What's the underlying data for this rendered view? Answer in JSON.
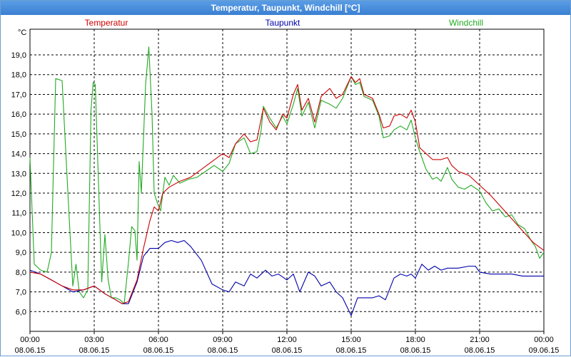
{
  "window": {
    "title": "Temperatur, Taupunkt, Windchill [°C]"
  },
  "colors": {
    "temperatur": "#cc0000",
    "taupunkt": "#0000aa",
    "windchill": "#22aa22",
    "grid": "#000000"
  },
  "chart_data": {
    "type": "line",
    "title": "Temperatur, Taupunkt, Windchill [°C]",
    "ylabel": "°C",
    "ylim": [
      5.0,
      20.3
    ],
    "xlim": [
      0,
      24
    ],
    "grid": true,
    "legend_placement": "top",
    "yticks": [
      "6,0",
      "7,0",
      "8,0",
      "9,0",
      "10,0",
      "11,0",
      "12,0",
      "13,0",
      "14,0",
      "15,0",
      "16,0",
      "17,0",
      "18,0",
      "19,0"
    ],
    "ytick_values": [
      6,
      7,
      8,
      9,
      10,
      11,
      12,
      13,
      14,
      15,
      16,
      17,
      18,
      19
    ],
    "xticks": [
      {
        "x": 0,
        "time": "00:00",
        "date": "08.06.15"
      },
      {
        "x": 3,
        "time": "03:00",
        "date": "08.06.15"
      },
      {
        "x": 6,
        "time": "06:00",
        "date": "08.06.15"
      },
      {
        "x": 9,
        "time": "09:00",
        "date": "08.06.15"
      },
      {
        "x": 12,
        "time": "12:00",
        "date": "08.06.15"
      },
      {
        "x": 15,
        "time": "15:00",
        "date": "08.06.15"
      },
      {
        "x": 18,
        "time": "18:00",
        "date": "08.06.15"
      },
      {
        "x": 21,
        "time": "21:00",
        "date": "08.06.15"
      },
      {
        "x": 24,
        "time": "00:00",
        "date": "09.06.15"
      }
    ],
    "x_unit": "hours since 00:00 08.06.15",
    "series": [
      {
        "name": "Temperatur",
        "color": "#cc0000",
        "points": [
          [
            0,
            8.0
          ],
          [
            0.5,
            7.9
          ],
          [
            1,
            7.6
          ],
          [
            1.5,
            7.3
          ],
          [
            2,
            7.1
          ],
          [
            2.5,
            7.1
          ],
          [
            3,
            7.3
          ],
          [
            3.5,
            6.9
          ],
          [
            4,
            6.6
          ],
          [
            4.3,
            6.4
          ],
          [
            4.6,
            6.5
          ],
          [
            5,
            7.6
          ],
          [
            5.3,
            9.2
          ],
          [
            5.6,
            10.6
          ],
          [
            5.8,
            11.3
          ],
          [
            6,
            11.1
          ],
          [
            6.2,
            12.0
          ],
          [
            6.5,
            12.3
          ],
          [
            7,
            12.6
          ],
          [
            7.5,
            12.8
          ],
          [
            8,
            13.2
          ],
          [
            8.5,
            13.6
          ],
          [
            9,
            14.0
          ],
          [
            9.3,
            13.8
          ],
          [
            9.6,
            14.5
          ],
          [
            10,
            15.0
          ],
          [
            10.3,
            14.6
          ],
          [
            10.6,
            14.7
          ],
          [
            10.9,
            16.3
          ],
          [
            11.2,
            15.6
          ],
          [
            11.5,
            15.2
          ],
          [
            11.8,
            16.0
          ],
          [
            12,
            15.8
          ],
          [
            12.3,
            17.0
          ],
          [
            12.5,
            17.5
          ],
          [
            12.7,
            16.2
          ],
          [
            13,
            16.8
          ],
          [
            13.3,
            15.6
          ],
          [
            13.6,
            16.9
          ],
          [
            14,
            17.3
          ],
          [
            14.3,
            16.8
          ],
          [
            14.6,
            17.0
          ],
          [
            15,
            17.9
          ],
          [
            15.2,
            17.6
          ],
          [
            15.4,
            17.8
          ],
          [
            15.6,
            17.0
          ],
          [
            16,
            16.8
          ],
          [
            16.3,
            16.0
          ],
          [
            16.5,
            15.3
          ],
          [
            16.8,
            15.4
          ],
          [
            17,
            15.9
          ],
          [
            17.3,
            16.0
          ],
          [
            17.6,
            15.8
          ],
          [
            17.8,
            16.2
          ],
          [
            18,
            15.6
          ],
          [
            18.2,
            14.3
          ],
          [
            18.5,
            14.0
          ],
          [
            18.8,
            13.7
          ],
          [
            19.2,
            13.7
          ],
          [
            19.5,
            13.8
          ],
          [
            19.7,
            13.4
          ],
          [
            20,
            13.1
          ],
          [
            20.5,
            12.9
          ],
          [
            21,
            12.4
          ],
          [
            21.5,
            11.9
          ],
          [
            22,
            11.3
          ],
          [
            22.5,
            10.7
          ],
          [
            23,
            10.1
          ],
          [
            23.5,
            9.5
          ],
          [
            24,
            9.1
          ]
        ]
      },
      {
        "name": "Taupunkt",
        "color": "#0000aa",
        "points": [
          [
            0,
            8.1
          ],
          [
            0.5,
            7.9
          ],
          [
            1,
            7.6
          ],
          [
            1.5,
            7.3
          ],
          [
            2,
            7.0
          ],
          [
            2.5,
            7.1
          ],
          [
            3,
            7.3
          ],
          [
            3.5,
            6.9
          ],
          [
            4,
            6.6
          ],
          [
            4.3,
            6.4
          ],
          [
            4.6,
            6.4
          ],
          [
            5,
            7.5
          ],
          [
            5.3,
            8.8
          ],
          [
            5.6,
            9.2
          ],
          [
            6,
            9.2
          ],
          [
            6.3,
            9.5
          ],
          [
            6.6,
            9.6
          ],
          [
            6.9,
            9.5
          ],
          [
            7.2,
            9.6
          ],
          [
            7.5,
            9.3
          ],
          [
            8,
            8.6
          ],
          [
            8.5,
            7.4
          ],
          [
            9,
            7.1
          ],
          [
            9.3,
            7.0
          ],
          [
            9.6,
            7.5
          ],
          [
            10,
            7.3
          ],
          [
            10.3,
            7.9
          ],
          [
            10.6,
            7.7
          ],
          [
            11,
            8.1
          ],
          [
            11.3,
            7.8
          ],
          [
            11.6,
            7.9
          ],
          [
            12,
            7.6
          ],
          [
            12.3,
            7.9
          ],
          [
            12.6,
            7.0
          ],
          [
            13,
            8.0
          ],
          [
            13.3,
            7.8
          ],
          [
            13.6,
            7.3
          ],
          [
            14,
            7.5
          ],
          [
            14.3,
            7.0
          ],
          [
            14.6,
            6.7
          ],
          [
            15,
            5.8
          ],
          [
            15.3,
            6.7
          ],
          [
            15.6,
            6.7
          ],
          [
            16,
            6.7
          ],
          [
            16.3,
            6.8
          ],
          [
            16.6,
            6.6
          ],
          [
            17,
            7.7
          ],
          [
            17.3,
            7.9
          ],
          [
            17.6,
            7.8
          ],
          [
            17.8,
            7.9
          ],
          [
            18,
            7.7
          ],
          [
            18.3,
            8.4
          ],
          [
            18.6,
            8.1
          ],
          [
            18.9,
            8.3
          ],
          [
            19.2,
            8.1
          ],
          [
            19.5,
            8.2
          ],
          [
            20,
            8.2
          ],
          [
            20.5,
            8.3
          ],
          [
            20.8,
            8.3
          ],
          [
            21,
            8.0
          ],
          [
            21.5,
            7.9
          ],
          [
            22,
            7.9
          ],
          [
            22.5,
            7.9
          ],
          [
            23,
            7.8
          ],
          [
            23.5,
            7.8
          ],
          [
            24,
            7.8
          ]
        ]
      },
      {
        "name": "Windchill",
        "color": "#22aa22",
        "points": [
          [
            0,
            13.8
          ],
          [
            0.2,
            8.4
          ],
          [
            0.5,
            8.1
          ],
          [
            0.8,
            8.0
          ],
          [
            1.0,
            9.0
          ],
          [
            1.2,
            17.8
          ],
          [
            1.5,
            17.7
          ],
          [
            1.8,
            11.4
          ],
          [
            2.0,
            7.3
          ],
          [
            2.15,
            8.4
          ],
          [
            2.3,
            7.0
          ],
          [
            2.5,
            6.7
          ],
          [
            2.7,
            7.1
          ],
          [
            2.85,
            16.2
          ],
          [
            2.95,
            17.6
          ],
          [
            3.05,
            17.5
          ],
          [
            3.2,
            12.5
          ],
          [
            3.35,
            7.5
          ],
          [
            3.5,
            9.9
          ],
          [
            3.65,
            7.6
          ],
          [
            3.8,
            6.7
          ],
          [
            4.0,
            6.7
          ],
          [
            4.2,
            6.6
          ],
          [
            4.4,
            6.4
          ],
          [
            4.6,
            8.5
          ],
          [
            4.75,
            10.3
          ],
          [
            4.9,
            10.1
          ],
          [
            5.0,
            8.6
          ],
          [
            5.1,
            13.6
          ],
          [
            5.2,
            12.0
          ],
          [
            5.4,
            17.5
          ],
          [
            5.55,
            19.4
          ],
          [
            5.7,
            16.0
          ],
          [
            5.8,
            12.0
          ],
          [
            5.95,
            11.5
          ],
          [
            6.1,
            11.1
          ],
          [
            6.3,
            12.8
          ],
          [
            6.5,
            12.4
          ],
          [
            6.7,
            12.9
          ],
          [
            7.0,
            12.5
          ],
          [
            7.4,
            12.7
          ],
          [
            7.8,
            12.8
          ],
          [
            8.2,
            13.1
          ],
          [
            8.6,
            13.4
          ],
          [
            9.0,
            13.1
          ],
          [
            9.3,
            13.5
          ],
          [
            9.6,
            14.5
          ],
          [
            10.0,
            14.8
          ],
          [
            10.3,
            14.0
          ],
          [
            10.6,
            14.1
          ],
          [
            10.8,
            15.2
          ],
          [
            10.9,
            16.4
          ],
          [
            11.2,
            15.8
          ],
          [
            11.5,
            15.3
          ],
          [
            11.8,
            15.9
          ],
          [
            12.0,
            15.5
          ],
          [
            12.3,
            16.5
          ],
          [
            12.5,
            17.3
          ],
          [
            12.7,
            15.9
          ],
          [
            13.0,
            16.6
          ],
          [
            13.3,
            15.3
          ],
          [
            13.6,
            16.7
          ],
          [
            14.0,
            16.5
          ],
          [
            14.3,
            16.3
          ],
          [
            14.6,
            16.8
          ],
          [
            15.0,
            17.9
          ],
          [
            15.2,
            17.5
          ],
          [
            15.4,
            17.6
          ],
          [
            15.6,
            16.9
          ],
          [
            16.0,
            16.7
          ],
          [
            16.3,
            15.9
          ],
          [
            16.5,
            14.8
          ],
          [
            16.8,
            14.9
          ],
          [
            17.0,
            15.2
          ],
          [
            17.3,
            15.4
          ],
          [
            17.6,
            15.2
          ],
          [
            17.8,
            15.7
          ],
          [
            18.0,
            14.8
          ],
          [
            18.2,
            14.1
          ],
          [
            18.5,
            13.2
          ],
          [
            18.8,
            12.7
          ],
          [
            19.0,
            12.8
          ],
          [
            19.2,
            12.6
          ],
          [
            19.5,
            13.3
          ],
          [
            19.7,
            12.7
          ],
          [
            20.0,
            12.3
          ],
          [
            20.3,
            12.2
          ],
          [
            20.6,
            12.4
          ],
          [
            21.0,
            12.1
          ],
          [
            21.3,
            11.5
          ],
          [
            21.6,
            11.1
          ],
          [
            21.9,
            11.2
          ],
          [
            22.2,
            10.8
          ],
          [
            22.5,
            10.9
          ],
          [
            22.8,
            10.4
          ],
          [
            23.1,
            10.2
          ],
          [
            23.4,
            9.6
          ],
          [
            23.6,
            9.3
          ],
          [
            23.8,
            8.7
          ],
          [
            24.0,
            9.0
          ]
        ]
      }
    ]
  }
}
